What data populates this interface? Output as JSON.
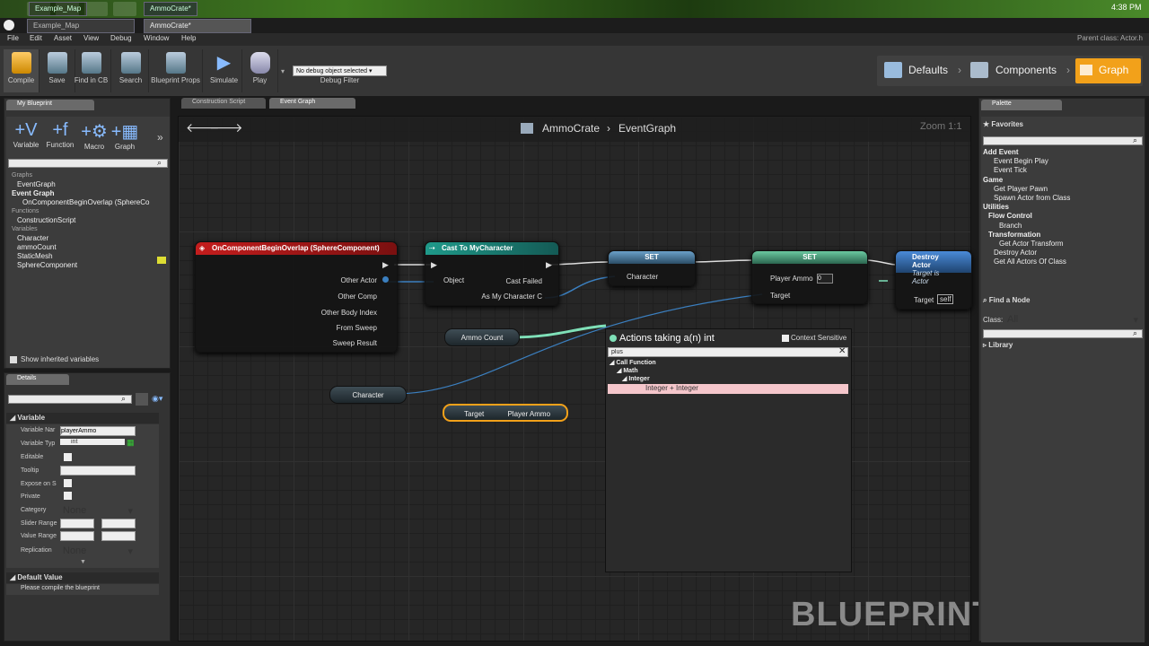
{
  "taskbar": {
    "tab1": "Example_Map",
    "tab2": "AmmoCrate*",
    "clock": "4:38 PM"
  },
  "menu": [
    "File",
    "Edit",
    "Asset",
    "View",
    "Debug",
    "Window",
    "Help"
  ],
  "parent_class": "Parent class: Actor.h",
  "toolbar": {
    "compile": "Compile",
    "save": "Save",
    "find": "Find in CB",
    "search": "Search",
    "bp_props": "Blueprint Props",
    "simulate": "Simulate",
    "play": "Play",
    "debug_select": "No debug object selected",
    "debug_filter": "Debug Filter"
  },
  "breadcrumbs": {
    "defaults": "Defaults",
    "components": "Components",
    "graph": "Graph"
  },
  "my_blueprint": {
    "tab": "My Blueprint",
    "buttons": [
      "Variable",
      "Function",
      "Macro",
      "Graph"
    ],
    "graphs_label": "Graphs",
    "event_graph": "EventGraph",
    "event_graph_section": "Event Graph",
    "overlap": "OnComponentBeginOverlap (SphereCo",
    "functions_label": "Functions",
    "construction": "ConstructionScript",
    "variables_label": "Variables",
    "variables": [
      "Character",
      "ammoCount",
      "StaticMesh",
      "SphereComponent"
    ],
    "show_inherited": "Show inherited variables"
  },
  "details": {
    "tab": "Details",
    "section": "Variable",
    "rows": {
      "name_label": "Variable Nar",
      "name_value": "playerAmmo",
      "type_label": "Variable Typ",
      "type_value": "int",
      "editable": "Editable",
      "tooltip": "Tooltip",
      "expose": "Expose on S",
      "private": "Private",
      "category": "Category",
      "category_value": "None",
      "slider": "Slider Range",
      "value_range": "Value Range",
      "replication": "Replication",
      "replication_value": "None"
    },
    "default_section": "Default Value",
    "default_msg": "Please compile the blueprint"
  },
  "graph_tabs": {
    "construction": "Construction Script",
    "event": "Event Graph"
  },
  "graph_header": {
    "bp": "AmmoCrate",
    "graph": "EventGraph",
    "zoom": "Zoom 1:1"
  },
  "nodes": {
    "overlap": {
      "title": "OnComponentBeginOverlap (SphereComponent)",
      "pins": [
        "Other Actor",
        "Other Comp",
        "Other Body Index",
        "From Sweep",
        "Sweep Result"
      ]
    },
    "cast": {
      "title": "Cast To MyCharacter",
      "object": "Object",
      "cast_failed": "Cast Failed",
      "as": "As My Character C"
    },
    "set1": {
      "title": "SET",
      "pin": "Character"
    },
    "set2": {
      "title": "SET",
      "pin": "Player Ammo",
      "value": "0",
      "target": "Target"
    },
    "destroy": {
      "title": "Destroy Actor",
      "sub": "Target is Actor",
      "target": "Target",
      "self": "self"
    },
    "ammo_count": "Ammo Count",
    "character": "Character",
    "target_ammo": {
      "target": "Target",
      "ammo": "Player Ammo"
    }
  },
  "actions": {
    "title": "Actions taking a(n) int",
    "context": "Context Sensitive",
    "query": "plus",
    "tree": [
      "Call Function",
      "Math",
      "Integer",
      "Integer + Integer"
    ]
  },
  "watermark": "BLUEPRINT",
  "palette": {
    "tab": "Palette",
    "favorites": "Favorites",
    "items": [
      {
        "t": "Add Event",
        "lvl": 0,
        "b": true
      },
      {
        "t": "Event Begin Play",
        "lvl": 2
      },
      {
        "t": "Event Tick",
        "lvl": 2
      },
      {
        "t": "Game",
        "lvl": 0,
        "b": true
      },
      {
        "t": "Get Player Pawn",
        "lvl": 2
      },
      {
        "t": "Spawn Actor from Class",
        "lvl": 2
      },
      {
        "t": "Utilities",
        "lvl": 0,
        "b": true
      },
      {
        "t": "Flow Control",
        "lvl": 1,
        "b": true
      },
      {
        "t": "Branch",
        "lvl": 3
      },
      {
        "t": "Transformation",
        "lvl": 1,
        "b": true
      },
      {
        "t": "Get Actor Transform",
        "lvl": 3
      },
      {
        "t": "Destroy Actor",
        "lvl": 2
      },
      {
        "t": "Get All Actors Of Class",
        "lvl": 2
      }
    ],
    "find_node": "Find a Node",
    "class_label": "Class:",
    "class_value": "All",
    "library": "Library"
  }
}
